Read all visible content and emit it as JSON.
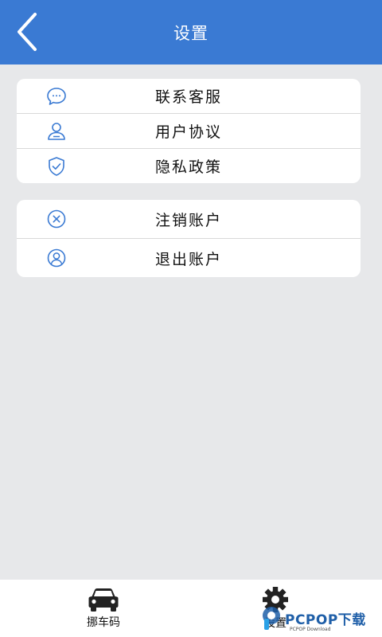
{
  "header": {
    "title": "设置",
    "back_icon": "chevron-left-icon",
    "background": "#3a7ad3"
  },
  "group1": {
    "items": [
      {
        "label": "联系客服",
        "icon": "chat-bubble-icon"
      },
      {
        "label": "用户协议",
        "icon": "user-agreement-icon"
      },
      {
        "label": "隐私政策",
        "icon": "shield-check-icon"
      }
    ]
  },
  "group2": {
    "items": [
      {
        "label": "注销账户",
        "icon": "close-circle-icon"
      },
      {
        "label": "退出账户",
        "icon": "user-circle-icon"
      }
    ]
  },
  "tabbar": {
    "tabs": [
      {
        "label": "挪车码",
        "icon": "car-icon"
      },
      {
        "label": "设置",
        "icon": "gear-icon"
      }
    ]
  },
  "watermark": {
    "text": "PCPOP下载",
    "sub": "PCPOP Download"
  },
  "colors": {
    "accent": "#3a7ad3",
    "page_background": "#e7e8ea",
    "icon_blue": "#3a7ad3"
  }
}
